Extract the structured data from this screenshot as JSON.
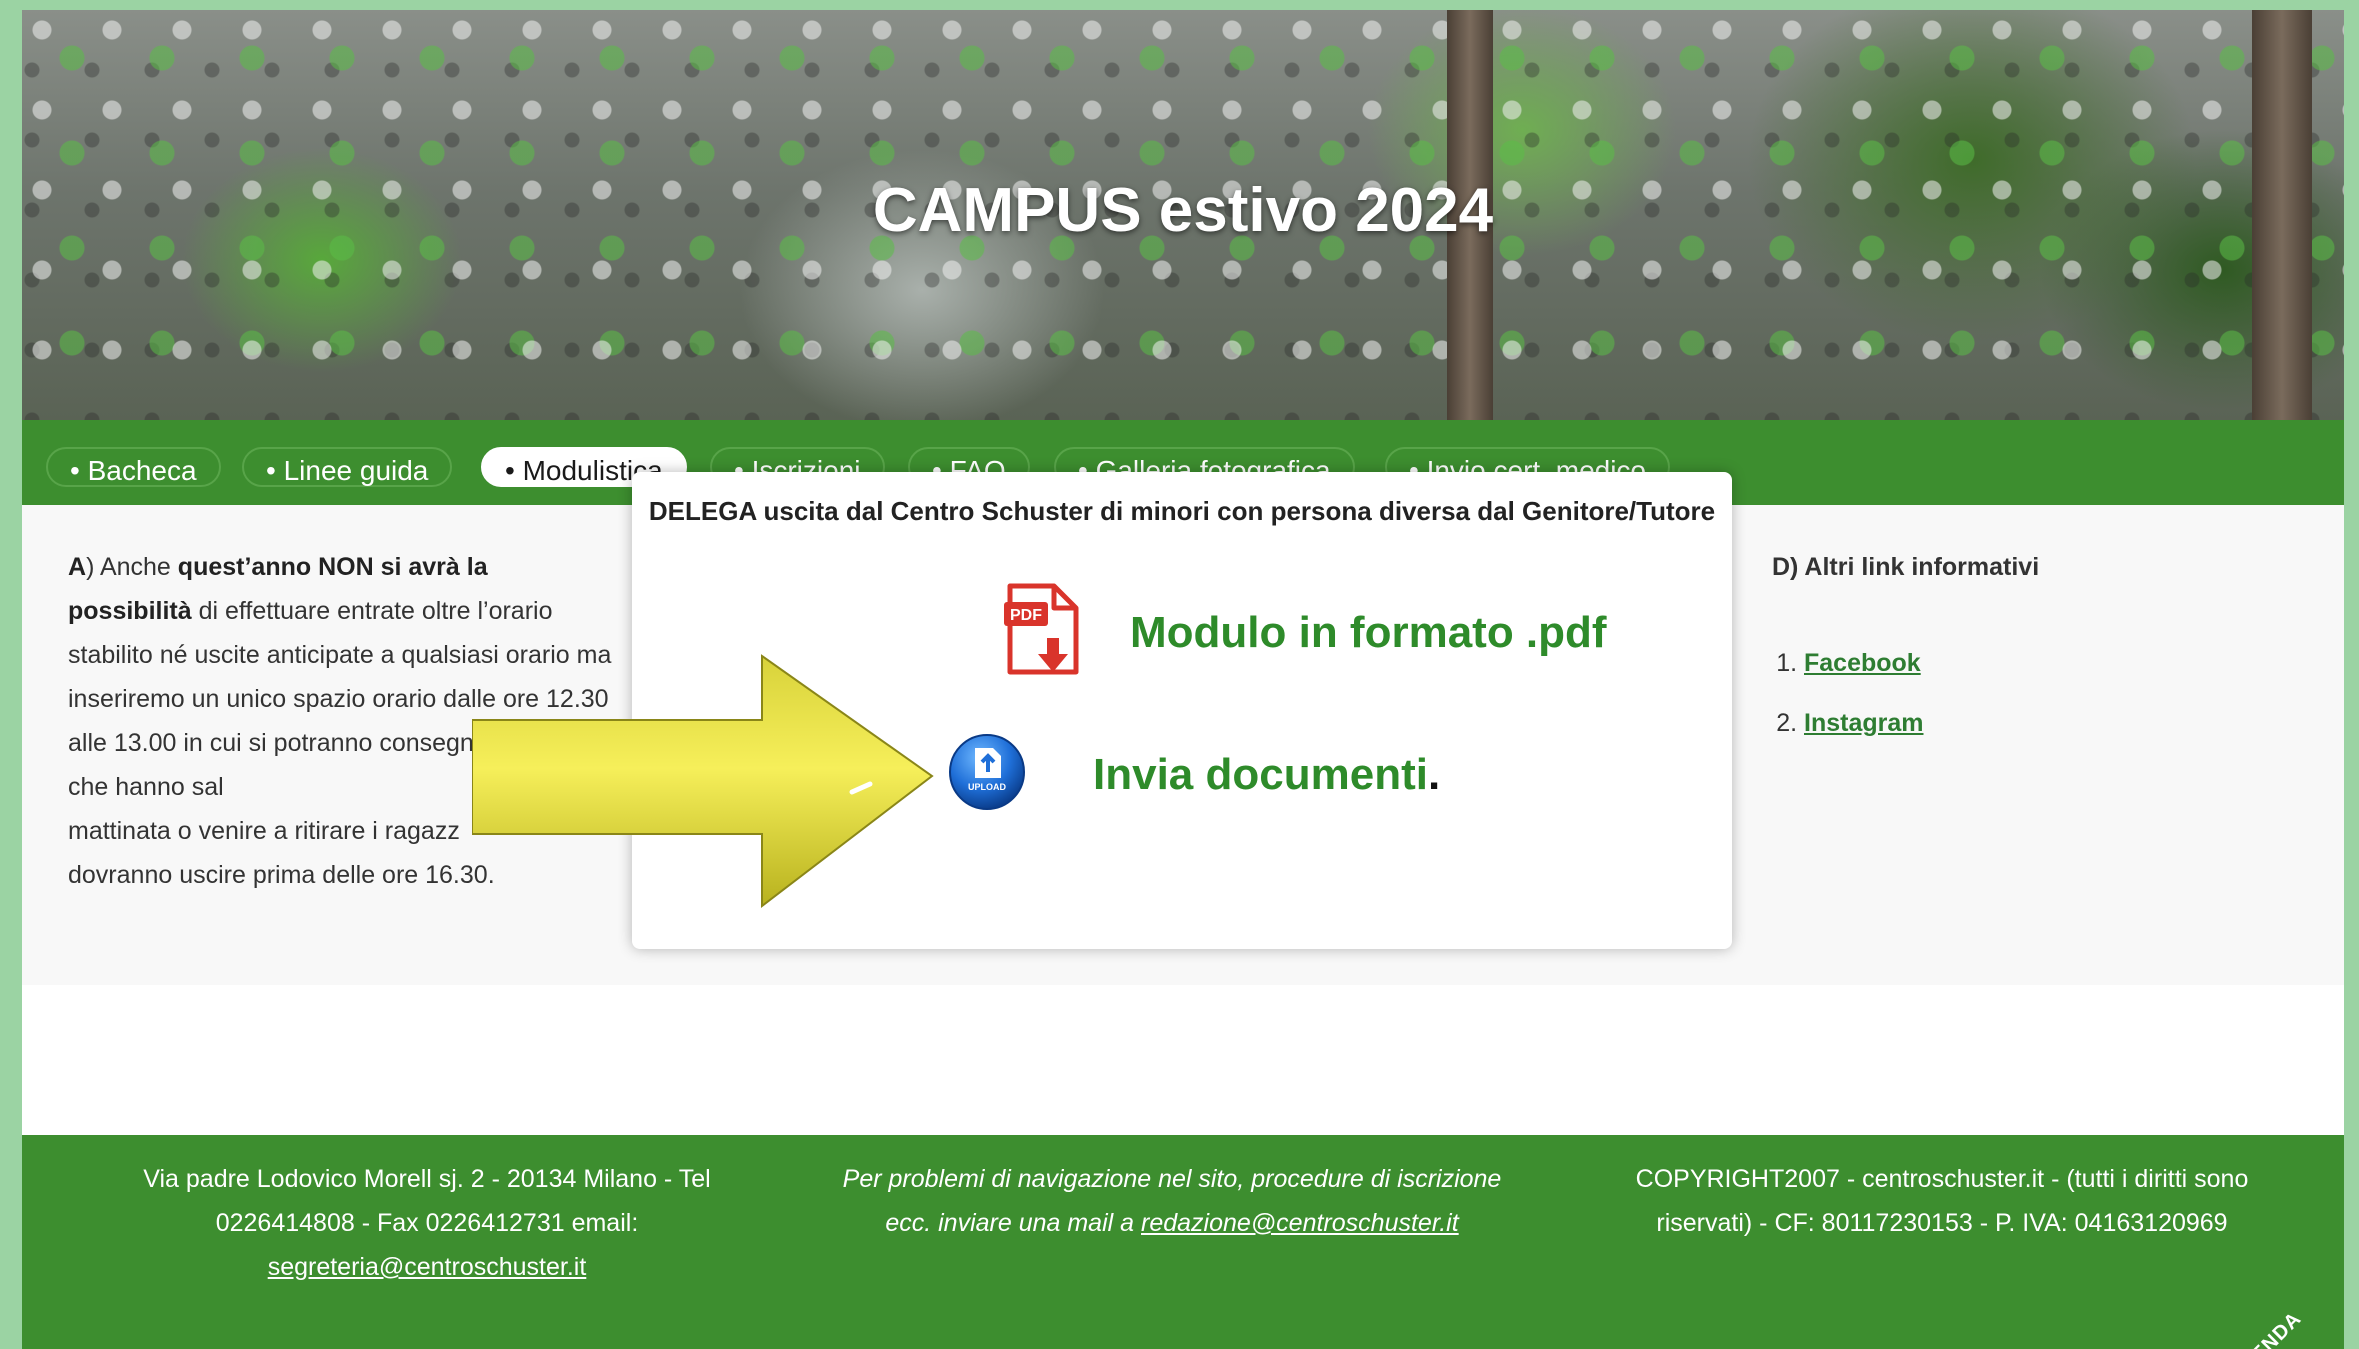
{
  "banner": {
    "title": "CAMPUS estivo 2024"
  },
  "nav": {
    "items": [
      {
        "label": "• Bacheca",
        "active": false
      },
      {
        "label": "• Linee guida",
        "active": false
      },
      {
        "label": "• Modulistica",
        "active": true
      },
      {
        "label": "• Iscrizioni",
        "active": false
      },
      {
        "label": "• FAQ",
        "active": false
      },
      {
        "label": "• Galleria fotografica",
        "active": false
      },
      {
        "label": "• Invio cert. medico",
        "active": false
      }
    ]
  },
  "content": {
    "section_a": {
      "letter": "A",
      "t1": ") Anche ",
      "bold1": "quest’anno NON si avrà la possibilità",
      "t2": " di effettuare entrate oltre l’orario stabilito né uscite anticipate a qualsiasi orario ma inseriremo un unico spazio orario dalle ore 12.30 alle 13.00 in cui si potranno consegnare i ragazzi che hanno sal",
      "t3": "mattinata o venire a ritirare i ragazz",
      "t4": "dovranno uscire prima delle ore 16.30."
    },
    "section_d": {
      "title": "D) Altri link informativi",
      "links": [
        "Facebook",
        "Instagram"
      ]
    }
  },
  "popup": {
    "title": "DELEGA uscita dal Centro Schuster di minori con persona diversa dal Genitore/Tutore",
    "pdf_icon_text": "PDF",
    "pdf_link": "Modulo in formato .pdf",
    "upload_icon_text": "UPLOAD",
    "upload_link": "Invia documenti",
    "upload_suffix": "."
  },
  "footer": {
    "address_line1": "Via padre Lodovico Morell sj. 2 - 20134 Milano - Tel",
    "address_line2": "0226414808 - Fax 0226412731 email:",
    "address_email": "segreteria@centroschuster.it",
    "help_line1": "Per problemi di navigazione nel sito, procedure di iscrizione",
    "help_line2": "ecc. inviare una mail a ",
    "help_email": "redazione@centroschuster.it",
    "copyright_line1": "COPYRIGHT2007 - centroschuster.it - (tutti i diritti sono",
    "copyright_line2": "riservati) - CF: 80117230153 - P. IVA: 04163120969",
    "agenda": "AGENDA"
  },
  "colors": {
    "green": "#3d8e2f",
    "link_green": "#2e8b2a",
    "arrow_yellow": "#f2e84a",
    "outer_bg": "#9bd3a3"
  }
}
